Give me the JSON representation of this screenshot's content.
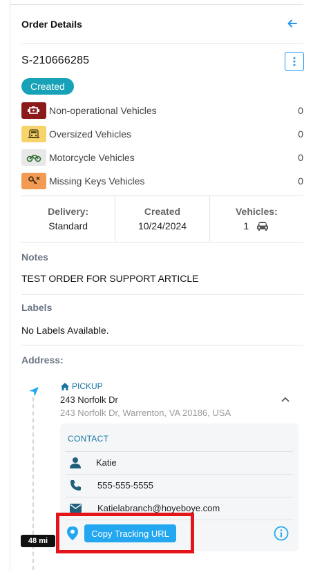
{
  "header": {
    "title": "Order Details"
  },
  "order": {
    "id": "S-210666285",
    "status": "Created"
  },
  "vehicle_types": [
    {
      "label": "Non-operational Vehicles",
      "count": "0",
      "icon": "engine-icon",
      "color": "#8b1a1a"
    },
    {
      "label": "Oversized Vehicles",
      "count": "0",
      "icon": "truck-icon",
      "color": "#f6d36b"
    },
    {
      "label": "Motorcycle Vehicles",
      "count": "0",
      "icon": "motorcycle-icon",
      "color": "#e8e8e8"
    },
    {
      "label": "Missing Keys Vehicles",
      "count": "0",
      "icon": "key-icon",
      "color": "#f39b52"
    }
  ],
  "stats": {
    "delivery_label": "Delivery:",
    "delivery_value": "Standard",
    "created_label": "Created",
    "created_value": "10/24/2024",
    "vehicles_label": "Vehicles:",
    "vehicles_value": "1"
  },
  "notes": {
    "label": "Notes",
    "text": "TEST ORDER FOR SUPPORT ARTICLE"
  },
  "labels": {
    "label": "Labels",
    "text": "No Labels Available."
  },
  "address": {
    "label": "Address:",
    "pickup_label": "PICKUP",
    "pickup_name": "243 Norfolk Dr",
    "pickup_full": "243 Norfolk Dr, Warrenton, VA 20186, USA"
  },
  "contact": {
    "title": "CONTACT",
    "name": "Katie",
    "phone": "555-555-5555",
    "email": "Katielabranch@hoyeboye.com"
  },
  "distance": "48 mi",
  "tracking": {
    "button_label": "Copy Tracking URL"
  },
  "colors": {
    "accent": "#22a7f0",
    "status": "#17a2b8",
    "highlight": "#e3151b",
    "dark_blue": "#1976a2"
  }
}
